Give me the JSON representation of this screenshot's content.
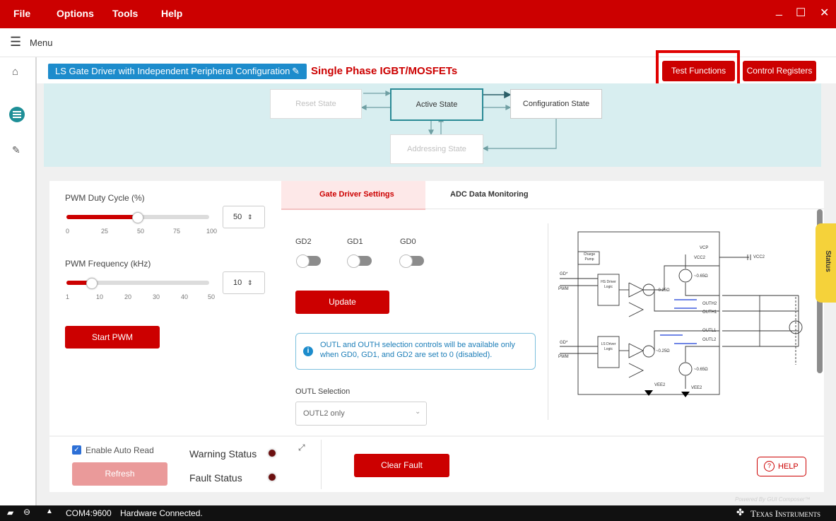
{
  "menu": {
    "file": "File",
    "options": "Options",
    "tools": "Tools",
    "help": "Help",
    "minimize": "_",
    "maximize": "☐",
    "close": "✕"
  },
  "menubar": {
    "label": "Menu"
  },
  "header": {
    "config_chip": "LS Gate Driver with Independent Peripheral Configuration",
    "subtitle": "Single Phase IGBT/MOSFETs",
    "test_functions": "Test Functions",
    "control_registers": "Control Registers"
  },
  "states": {
    "reset": "Reset State",
    "active": "Active State",
    "configuration": "Configuration State",
    "addressing": "Addressing State"
  },
  "pwm": {
    "duty_label": "PWM Duty Cycle (%)",
    "duty_value": "50",
    "duty_ticks": [
      "0",
      "25",
      "50",
      "75",
      "100"
    ],
    "duty_fraction": 0.5,
    "freq_label": "PWM Frequency (kHz)",
    "freq_value": "10",
    "freq_ticks": [
      "1",
      "10",
      "20",
      "30",
      "40",
      "50"
    ],
    "freq_fraction": 0.18,
    "start": "Start PWM"
  },
  "tabs": {
    "gate": "Gate Driver Settings",
    "adc": "ADC Data Monitoring"
  },
  "gate": {
    "gd2": "GD2",
    "gd1": "GD1",
    "gd0": "GD0",
    "update": "Update",
    "info": "OUTL and OUTH selection controls will be available only when GD0, GD1, and GD2 are set to 0 (disabled).",
    "outl_label": "OUTL Selection",
    "outl_value": "OUTL2 only"
  },
  "schematic": {
    "charge_pump": "Charge Pump",
    "vcp": "VCP",
    "vcc2": "VCC2",
    "vcc2b": "VCC2",
    "hs_logic": "HS Driver Logic",
    "ls_logic": "LS Driver Logic",
    "gd_top": "GD*",
    "pwm_top": "PWM",
    "gd_bot": "GD*",
    "pwm_bot": "PWM",
    "r1": "~0.65Ω",
    "r2": "~0.25Ω",
    "r3": "~0.25Ω",
    "r4": "~0.65Ω",
    "outh2": "OUTH2",
    "outh1": "OUTH1",
    "outl1": "OUTL1",
    "outl2": "OUTL2",
    "vee2a": "VEE2",
    "vee2b": "VEE2"
  },
  "side_tab": "Status",
  "footer": {
    "auto_read": "Enable Auto Read",
    "refresh": "Refresh",
    "warning": "Warning Status",
    "fault": "Fault Status",
    "clear_fault": "Clear Fault",
    "help": "HELP",
    "powered": "Powered By GUI Composer™"
  },
  "statusbar": {
    "port": "COM4:9600",
    "status": "Hardware Connected.",
    "brand": "Texas Instruments"
  },
  "colors": {
    "accent": "#cc0000",
    "chip_blue": "#1d8ccc",
    "state_active": "#2a8a95"
  }
}
